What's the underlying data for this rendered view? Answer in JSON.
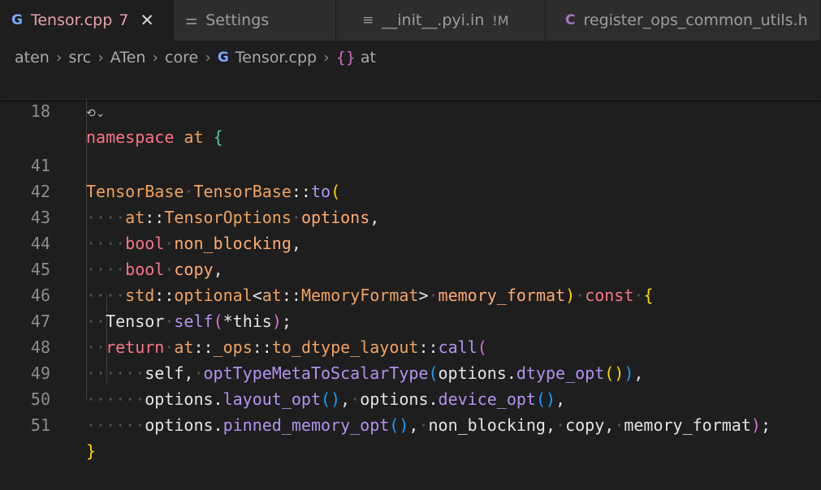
{
  "tabs": [
    {
      "label": "Tensor.cpp",
      "badge": "7",
      "icon": "cpp-icon",
      "active": true
    },
    {
      "label": "Settings",
      "icon": "settings-sliders-icon",
      "active": false
    },
    {
      "label": "__init__.pyi.in",
      "status": "!M",
      "icon": "text-file-icon",
      "active": false
    },
    {
      "label": "register_ops_common_utils.h",
      "icon": "c-header-icon",
      "active": false
    }
  ],
  "breadcrumb": {
    "parts": [
      "aten",
      "src",
      "ATen",
      "core",
      "Tensor.cpp",
      "at"
    ]
  },
  "sticky_line": {
    "number": "18",
    "kw": "namespace",
    "name": "at",
    "brace": "{"
  },
  "code_lines": {
    "l41": {
      "n": "41"
    },
    "l42": {
      "n": "42"
    },
    "l43": {
      "n": "43"
    },
    "l44": {
      "n": "44"
    },
    "l45": {
      "n": "45"
    },
    "l46": {
      "n": "46"
    },
    "l47": {
      "n": "47"
    },
    "l48": {
      "n": "48"
    },
    "l49": {
      "n": "49"
    },
    "l50": {
      "n": "50"
    },
    "l51": {
      "n": "51"
    }
  },
  "tokens": {
    "tensorbase": "TensorBase",
    "tensorbase2": "TensorBase",
    "scope": "::",
    "to": "to",
    "at": "at",
    "tensoroptions": "TensorOptions",
    "options": "options",
    "bool": "bool",
    "non_blocking": "non_blocking",
    "copy": "copy",
    "std": "std",
    "optional": "optional",
    "memoryformat": "MemoryFormat",
    "memory_format": "memory_format",
    "const": "const",
    "tensor": "Tensor",
    "self": "self",
    "this": "*this",
    "return": "return",
    "ops": "_ops",
    "to_dtype_layout": "to_dtype_layout",
    "call": "call",
    "optTypeMeta": "optTypeMetaToScalarType",
    "dtype_opt": "dtype_opt",
    "layout_opt": "layout_opt",
    "device_opt": "device_opt",
    "pinned_memory_opt": "pinned_memory_opt"
  }
}
